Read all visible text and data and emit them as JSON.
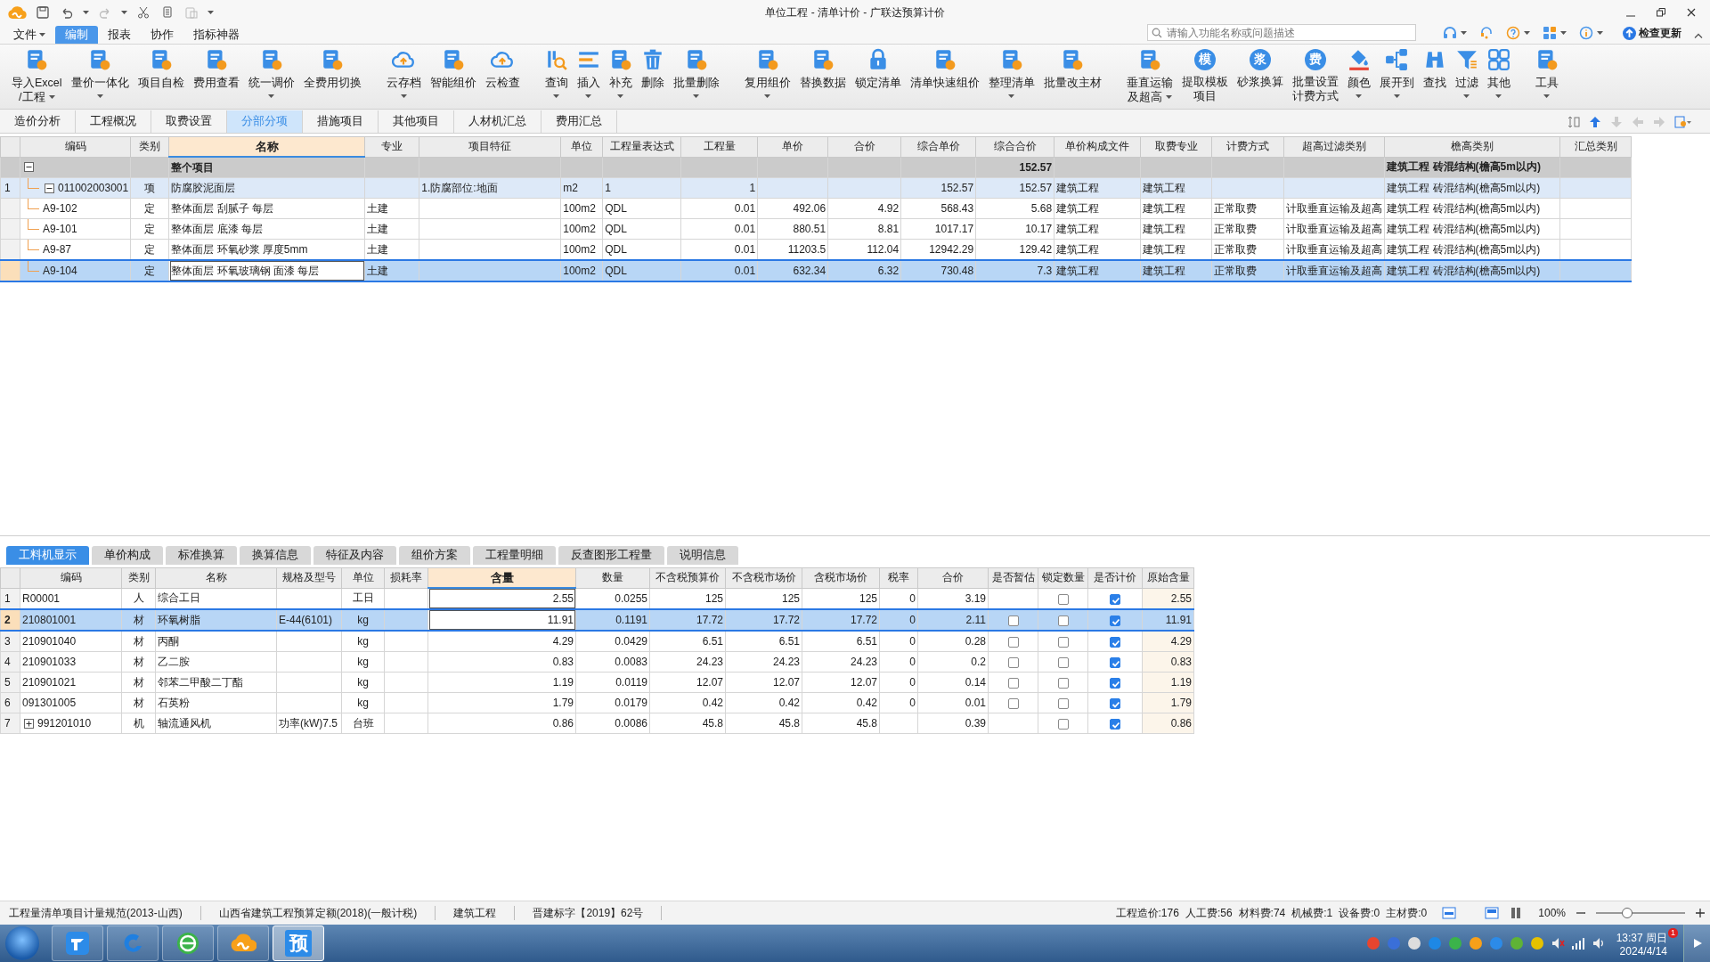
{
  "window": {
    "title": "单位工程 - 清单计价 - 广联达预算计价"
  },
  "menu": [
    {
      "label": "文件",
      "selected": false,
      "dropdown": true
    },
    {
      "label": "编制",
      "selected": true,
      "dropdown": false
    },
    {
      "label": "报表",
      "selected": false,
      "dropdown": false
    },
    {
      "label": "协作",
      "selected": false,
      "dropdown": false
    },
    {
      "label": "指标神器",
      "selected": false,
      "dropdown": false
    }
  ],
  "search": {
    "placeholder": "请输入功能名称或问题描述"
  },
  "update_button": "检查更新",
  "toolbar_groups": [
    [
      {
        "kind": "doc",
        "lines": [
          "导入Excel",
          "/工程"
        ],
        "dropdown": true
      },
      {
        "kind": "doc",
        "lines": [
          "量价一体化"
        ],
        "dropdown": true
      },
      {
        "kind": "doc",
        "lines": [
          "项目自检"
        ],
        "dropdown": false
      },
      {
        "kind": "doc",
        "lines": [
          "费用查看"
        ],
        "dropdown": false
      },
      {
        "kind": "doc",
        "lines": [
          "统一调价"
        ],
        "dropdown": true
      },
      {
        "kind": "doc",
        "lines": [
          "全费用切换"
        ],
        "dropdown": false
      }
    ],
    [
      {
        "kind": "cloud",
        "lines": [
          "云存档"
        ],
        "dropdown": true
      },
      {
        "kind": "doc",
        "lines": [
          "智能组价"
        ],
        "dropdown": false
      },
      {
        "kind": "cloud",
        "lines": [
          "云检查"
        ],
        "dropdown": false
      }
    ],
    [
      {
        "kind": "magnifier",
        "lines": [
          "查询"
        ],
        "dropdown": true
      },
      {
        "kind": "list",
        "lines": [
          "插入"
        ],
        "dropdown": true
      },
      {
        "kind": "doc",
        "lines": [
          "补充"
        ],
        "dropdown": true
      },
      {
        "kind": "trash",
        "lines": [
          "删除"
        ],
        "dropdown": false
      },
      {
        "kind": "doc",
        "lines": [
          "批量删除"
        ],
        "dropdown": true
      }
    ],
    [
      {
        "kind": "doc",
        "lines": [
          "复用组价"
        ],
        "dropdown": true
      },
      {
        "kind": "doc",
        "lines": [
          "替换数据"
        ],
        "dropdown": false
      },
      {
        "kind": "lock",
        "lines": [
          "锁定清单"
        ],
        "dropdown": false
      },
      {
        "kind": "doc",
        "lines": [
          "清单快速组价"
        ],
        "dropdown": false
      },
      {
        "kind": "doc",
        "lines": [
          "整理清单"
        ],
        "dropdown": true
      },
      {
        "kind": "doc",
        "lines": [
          "批量改主材"
        ],
        "dropdown": false
      }
    ],
    [
      {
        "kind": "doc",
        "lines": [
          "垂直运输",
          "及超高"
        ],
        "dropdown": true
      },
      {
        "kind": "glyph",
        "glyph": "模",
        "lines": [
          "提取模板",
          "项目"
        ],
        "dropdown": false
      },
      {
        "kind": "glyph",
        "glyph": "浆",
        "lines": [
          "砂浆换算"
        ],
        "dropdown": false
      },
      {
        "kind": "glyph",
        "glyph": "费",
        "lines": [
          "批量设置",
          "计费方式"
        ],
        "dropdown": false
      },
      {
        "kind": "bucket",
        "lines": [
          "颜色"
        ],
        "dropdown": true
      },
      {
        "kind": "tree",
        "lines": [
          "展开到"
        ],
        "dropdown": true
      },
      {
        "kind": "binoculars",
        "lines": [
          "查找"
        ],
        "dropdown": false
      },
      {
        "kind": "funnel",
        "lines": [
          "过滤"
        ],
        "dropdown": true
      },
      {
        "kind": "grid",
        "lines": [
          "其他"
        ],
        "dropdown": true
      }
    ],
    [
      {
        "kind": "doc",
        "lines": [
          "工具"
        ],
        "dropdown": true
      }
    ]
  ],
  "page_tabs": [
    {
      "label": "造价分析",
      "selected": false
    },
    {
      "label": "工程概况",
      "selected": false
    },
    {
      "label": "取费设置",
      "selected": false
    },
    {
      "label": "分部分项",
      "selected": true
    },
    {
      "label": "措施项目",
      "selected": false
    },
    {
      "label": "其他项目",
      "selected": false
    },
    {
      "label": "人材机汇总",
      "selected": false
    },
    {
      "label": "费用汇总",
      "selected": false
    }
  ],
  "top_grid": {
    "columns": [
      {
        "label": "编码",
        "highlighted": false
      },
      {
        "label": "类别",
        "highlighted": false
      },
      {
        "label": "名称",
        "highlighted": true
      },
      {
        "label": "专业",
        "highlighted": false
      },
      {
        "label": "项目特征",
        "highlighted": false
      },
      {
        "label": "单位",
        "highlighted": false
      },
      {
        "label": "工程量表达式",
        "highlighted": false
      },
      {
        "label": "工程量",
        "highlighted": false
      },
      {
        "label": "单价",
        "highlighted": false
      },
      {
        "label": "合价",
        "highlighted": false
      },
      {
        "label": "综合单价",
        "highlighted": false
      },
      {
        "label": "综合合价",
        "highlighted": false
      },
      {
        "label": "单价构成文件",
        "highlighted": false
      },
      {
        "label": "取费专业",
        "highlighted": false
      },
      {
        "label": "计费方式",
        "highlighted": false
      },
      {
        "label": "超高过滤类别",
        "highlighted": false
      },
      {
        "label": "檐高类别",
        "highlighted": false
      },
      {
        "label": "汇总类别",
        "highlighted": false
      }
    ],
    "rows": [
      {
        "kind": "group",
        "selected": false,
        "expanded": true,
        "name": "整个项目",
        "total": "152.57",
        "eave_class": "建筑工程 砖混结构(檐高5m以内)"
      },
      {
        "kind": "bill",
        "row_number": "1",
        "selected": false,
        "expanded": true,
        "code": "011002003001",
        "type": "项",
        "name": "防腐胶泥面层",
        "feature": "1.防腐部位:地面",
        "unit": "m2",
        "qty_expr": "1",
        "qty": "1",
        "unit_total": "152.57",
        "total": "152.57",
        "price_file": "建筑工程",
        "fee_major": "建筑工程",
        "eave_class": "建筑工程 砖混结构(檐高5m以内)"
      },
      {
        "kind": "quota",
        "selected": false,
        "code": "A9-102",
        "type": "定",
        "name": "整体面层 刮腻子 每层",
        "major": "土建",
        "unit": "100m2",
        "qty_expr": "QDL",
        "qty": "0.01",
        "price": "492.06",
        "amount": "4.92",
        "unit_total": "568.43",
        "total": "5.68",
        "price_file": "建筑工程",
        "fee_major": "建筑工程",
        "fee_mode": "正常取费",
        "height_filter": "计取垂直运输及超高",
        "eave_class": "建筑工程 砖混结构(檐高5m以内)"
      },
      {
        "kind": "quota",
        "selected": false,
        "code": "A9-101",
        "type": "定",
        "name": "整体面层 底漆 每层",
        "major": "土建",
        "unit": "100m2",
        "qty_expr": "QDL",
        "qty": "0.01",
        "price": "880.51",
        "amount": "8.81",
        "unit_total": "1017.17",
        "total": "10.17",
        "price_file": "建筑工程",
        "fee_major": "建筑工程",
        "fee_mode": "正常取费",
        "height_filter": "计取垂直运输及超高",
        "eave_class": "建筑工程 砖混结构(檐高5m以内)"
      },
      {
        "kind": "quota",
        "selected": false,
        "code": "A9-87",
        "type": "定",
        "name": "整体面层 环氧砂浆 厚度5mm",
        "major": "土建",
        "unit": "100m2",
        "qty_expr": "QDL",
        "qty": "0.01",
        "price": "11203.5",
        "amount": "112.04",
        "unit_total": "12942.29",
        "total": "129.42",
        "price_file": "建筑工程",
        "fee_major": "建筑工程",
        "fee_mode": "正常取费",
        "height_filter": "计取垂直运输及超高",
        "eave_class": "建筑工程 砖混结构(檐高5m以内)"
      },
      {
        "kind": "quota",
        "selected": true,
        "code": "A9-104",
        "type": "定",
        "name": "整体面层 环氧玻璃钢 面漆 每层",
        "major": "土建",
        "unit": "100m2",
        "qty_expr": "QDL",
        "qty": "0.01",
        "price": "632.34",
        "amount": "6.32",
        "unit_total": "730.48",
        "total": "7.3",
        "price_file": "建筑工程",
        "fee_major": "建筑工程",
        "fee_mode": "正常取费",
        "height_filter": "计取垂直运输及超高",
        "eave_class": "建筑工程 砖混结构(檐高5m以内)"
      }
    ]
  },
  "bottom_tabs": [
    {
      "label": "工料机显示",
      "selected": true
    },
    {
      "label": "单价构成",
      "selected": false
    },
    {
      "label": "标准换算",
      "selected": false
    },
    {
      "label": "换算信息",
      "selected": false
    },
    {
      "label": "特征及内容",
      "selected": false
    },
    {
      "label": "组价方案",
      "selected": false
    },
    {
      "label": "工程量明细",
      "selected": false
    },
    {
      "label": "反查图形工程量",
      "selected": false
    },
    {
      "label": "说明信息",
      "selected": false
    }
  ],
  "bottom_grid": {
    "columns": [
      {
        "label": "编码",
        "highlighted": false
      },
      {
        "label": "类别",
        "highlighted": false
      },
      {
        "label": "名称",
        "highlighted": false
      },
      {
        "label": "规格及型号",
        "highlighted": false
      },
      {
        "label": "单位",
        "highlighted": false
      },
      {
        "label": "损耗率",
        "highlighted": false
      },
      {
        "label": "含量",
        "highlighted": true
      },
      {
        "label": "数量",
        "highlighted": false
      },
      {
        "label": "不含税预算价",
        "highlighted": false
      },
      {
        "label": "不含税市场价",
        "highlighted": false
      },
      {
        "label": "含税市场价",
        "highlighted": false
      },
      {
        "label": "税率",
        "highlighted": false
      },
      {
        "label": "合价",
        "highlighted": false
      },
      {
        "label": "是否暂估",
        "highlighted": false
      },
      {
        "label": "锁定数量",
        "highlighted": false
      },
      {
        "label": "是否计价",
        "highlighted": false
      },
      {
        "label": "原始含量",
        "highlighted": false
      }
    ],
    "rows": [
      {
        "row_number": "1",
        "selected": false,
        "code": "R00001",
        "type": "人",
        "name": "综合工日",
        "unit": "工日",
        "content": "2.55",
        "quantity": "0.0255",
        "budget_ex_tax": "125",
        "market_ex_tax": "125",
        "market_inc_tax": "125",
        "tax_rate": "0",
        "amount": "3.19",
        "lock": false,
        "priced": true,
        "original": "2.55"
      },
      {
        "row_number": "2",
        "selected": true,
        "code": "210801001",
        "type": "材",
        "name": "环氧树脂",
        "spec": "E-44(6101)",
        "unit": "kg",
        "content": "11.91",
        "quantity": "0.1191",
        "budget_ex_tax": "17.72",
        "market_ex_tax": "17.72",
        "market_inc_tax": "17.72",
        "tax_rate": "0",
        "amount": "2.11",
        "estimate": false,
        "lock": false,
        "priced": true,
        "original": "11.91"
      },
      {
        "row_number": "3",
        "selected": false,
        "code": "210901040",
        "type": "材",
        "name": "丙酮",
        "unit": "kg",
        "content": "4.29",
        "quantity": "0.0429",
        "budget_ex_tax": "6.51",
        "market_ex_tax": "6.51",
        "market_inc_tax": "6.51",
        "tax_rate": "0",
        "amount": "0.28",
        "estimate": false,
        "lock": false,
        "priced": true,
        "original": "4.29"
      },
      {
        "row_number": "4",
        "selected": false,
        "code": "210901033",
        "type": "材",
        "name": "乙二胺",
        "unit": "kg",
        "content": "0.83",
        "quantity": "0.0083",
        "budget_ex_tax": "24.23",
        "market_ex_tax": "24.23",
        "market_inc_tax": "24.23",
        "tax_rate": "0",
        "amount": "0.2",
        "estimate": false,
        "lock": false,
        "priced": true,
        "original": "0.83"
      },
      {
        "row_number": "5",
        "selected": false,
        "code": "210901021",
        "type": "材",
        "name": "邻苯二甲酸二丁酯",
        "unit": "kg",
        "content": "1.19",
        "quantity": "0.0119",
        "budget_ex_tax": "12.07",
        "market_ex_tax": "12.07",
        "market_inc_tax": "12.07",
        "tax_rate": "0",
        "amount": "0.14",
        "estimate": false,
        "lock": false,
        "priced": true,
        "original": "1.19"
      },
      {
        "row_number": "6",
        "selected": false,
        "code": "091301005",
        "type": "材",
        "name": "石英粉",
        "unit": "kg",
        "content": "1.79",
        "quantity": "0.0179",
        "budget_ex_tax": "0.42",
        "market_ex_tax": "0.42",
        "market_inc_tax": "0.42",
        "tax_rate": "0",
        "amount": "0.01",
        "estimate": false,
        "lock": false,
        "priced": true,
        "original": "1.79"
      },
      {
        "row_number": "7",
        "selected": false,
        "expanded": false,
        "code": "991201010",
        "type": "机",
        "name": "轴流通风机",
        "spec": "功率(kW)7.5",
        "unit": "台班",
        "content": "0.86",
        "quantity": "0.0086",
        "budget_ex_tax": "45.8",
        "market_ex_tax": "45.8",
        "market_inc_tax": "45.8",
        "amount": "0.39",
        "lock": false,
        "priced": true,
        "original": "0.86"
      }
    ]
  },
  "status_bar": {
    "left": [
      "工程量清单项目计量规范(2013-山西)",
      "山西省建筑工程预算定额(2018)(一般计税)",
      "建筑工程",
      "晋建标字【2019】62号"
    ],
    "totals": [
      "工程造价:176",
      "人工费:56",
      "材料费:74",
      "机械费:1",
      "设备费:0",
      "主材费:0"
    ],
    "zoom": "100%",
    "zoom_slider": {
      "level": 0.35
    }
  },
  "taskbar": {
    "apps": [
      {
        "kind": "tile",
        "active": false
      },
      {
        "kind": "swirl",
        "active": false
      },
      {
        "kind": "browser",
        "active": false
      },
      {
        "kind": "cloud",
        "active": false
      },
      {
        "kind": "glyph",
        "glyph": "预",
        "active": true
      }
    ],
    "clock": {
      "time": "13:37 周日",
      "date": "2024/4/14",
      "badge": "1"
    }
  }
}
